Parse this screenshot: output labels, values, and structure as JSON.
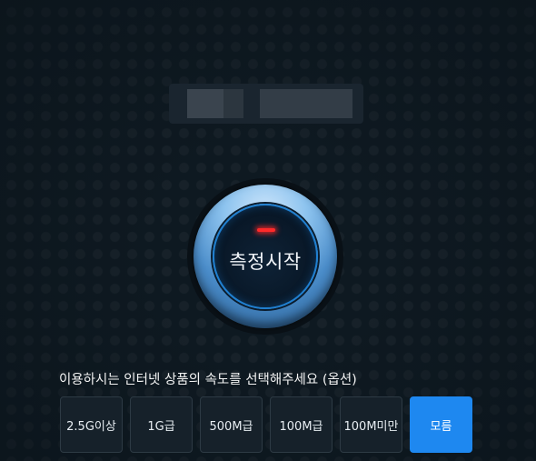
{
  "start_button": {
    "label": "측정시작",
    "indicator_color": "#ff2a2a",
    "ring_color": "#4a8cc9"
  },
  "speed_selection": {
    "title": "이용하시는 인터넷 상품의 속도를 선택해주세요 (옵션)",
    "options": [
      {
        "label": "2.5G이상"
      },
      {
        "label": "1G급"
      },
      {
        "label": "500M급"
      },
      {
        "label": "100M급"
      },
      {
        "label": "100M미만"
      },
      {
        "label": "모름"
      }
    ],
    "selected_index": 5,
    "selected_color": "#1e88f0"
  }
}
